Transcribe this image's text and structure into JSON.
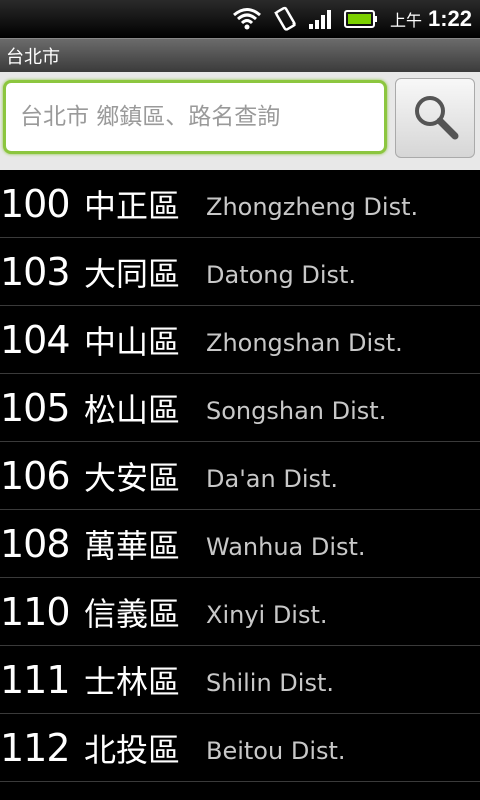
{
  "status_bar": {
    "icons": [
      "wifi-icon",
      "vibrate-icon",
      "signal-icon",
      "battery-icon"
    ],
    "ampm": "上午",
    "time": "1:22"
  },
  "title_bar": {
    "title": "台北市"
  },
  "search": {
    "placeholder": "台北市 鄉鎮區、路名查詢",
    "value": "",
    "button_icon": "search-icon"
  },
  "districts": [
    {
      "code": "100",
      "zh": "中正區",
      "en": "Zhongzheng Dist."
    },
    {
      "code": "103",
      "zh": "大同區",
      "en": "Datong Dist."
    },
    {
      "code": "104",
      "zh": "中山區",
      "en": "Zhongshan Dist."
    },
    {
      "code": "105",
      "zh": "松山區",
      "en": "Songshan Dist."
    },
    {
      "code": "106",
      "zh": "大安區",
      "en": "Da'an Dist."
    },
    {
      "code": "108",
      "zh": "萬華區",
      "en": "Wanhua Dist."
    },
    {
      "code": "110",
      "zh": "信義區",
      "en": "Xinyi Dist."
    },
    {
      "code": "111",
      "zh": "士林區",
      "en": "Shilin Dist."
    },
    {
      "code": "112",
      "zh": "北投區",
      "en": "Beitou Dist."
    }
  ],
  "colors": {
    "focus_border": "#8cc63f",
    "battery": "#7cd000"
  }
}
